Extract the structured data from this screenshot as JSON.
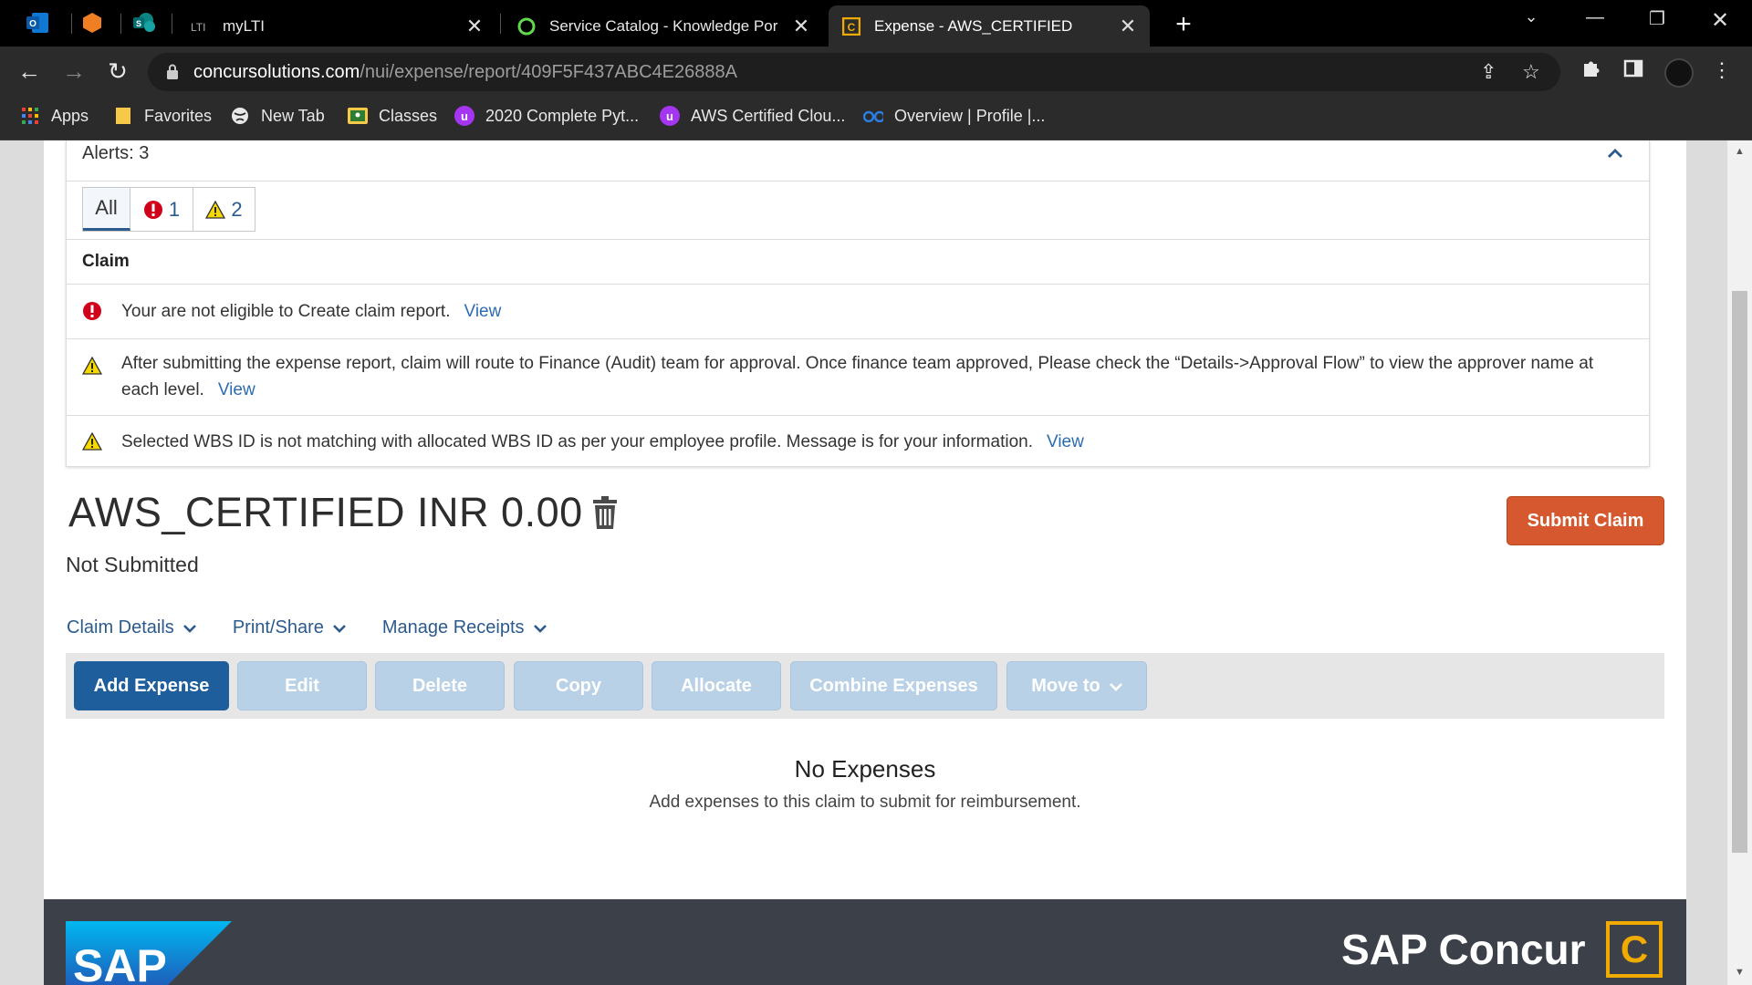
{
  "browser": {
    "tabs": [
      {
        "label": "myLTI"
      },
      {
        "label": "Service Catalog - Knowledge Por"
      },
      {
        "label": "Expense - AWS_CERTIFIED"
      }
    ],
    "url_host": "concursolutions.com",
    "url_path": "/nui/expense/report/409F5F437ABC4E26888A",
    "bookmarks": [
      {
        "label": "Apps"
      },
      {
        "label": "Favorites"
      },
      {
        "label": "New Tab"
      },
      {
        "label": "Classes"
      },
      {
        "label": "2020 Complete Pyt..."
      },
      {
        "label": "AWS Certified Clou..."
      },
      {
        "label": "Overview | Profile |..."
      }
    ]
  },
  "alerts": {
    "title": "Alerts: 3",
    "filters": {
      "all": "All",
      "errors": "1",
      "warnings": "2"
    },
    "section_label": "Claim",
    "items": [
      {
        "type": "error",
        "text": "Your are not eligible to Create claim report.",
        "link": "View"
      },
      {
        "type": "warning",
        "text": "After submitting the expense report, claim will route to Finance (Audit) team for approval. Once finance team approved, Please check the “Details->Approval Flow” to view the approver name at each level.",
        "link": "View"
      },
      {
        "type": "warning",
        "text": "Selected WBS ID is not matching with allocated WBS ID as per your employee profile. Message is for your information.",
        "link": "View"
      }
    ]
  },
  "report": {
    "title": "AWS_CERTIFIED INR 0.00",
    "status": "Not Submitted",
    "submit_label": "Submit Claim"
  },
  "menus": {
    "claim_details": "Claim Details",
    "print_share": "Print/Share",
    "manage_receipts": "Manage Receipts"
  },
  "actions": {
    "add_expense": "Add Expense",
    "edit": "Edit",
    "delete": "Delete",
    "copy": "Copy",
    "allocate": "Allocate",
    "combine": "Combine Expenses",
    "move_to": "Move to"
  },
  "empty_state": {
    "title": "No Expenses",
    "subtitle": "Add expenses to this claim to submit for reimbursement."
  },
  "footer": {
    "sap": "SAP",
    "concur": "SAP Concur",
    "concur_mark": "C"
  },
  "colors": {
    "primary": "#1f5e9c",
    "submit": "#d5582e",
    "error": "#d0021b",
    "warning": "#f5d800",
    "concur_gold": "#f0ab00"
  }
}
